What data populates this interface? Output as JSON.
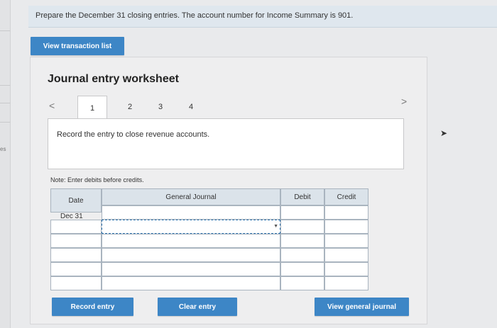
{
  "instruction": "Prepare the December 31 closing entries. The account number for Income Summary is 901.",
  "left_edge_label": "es",
  "buttons": {
    "view_transactions": "View transaction list",
    "record_entry": "Record entry",
    "clear_entry": "Clear entry",
    "view_general_journal": "View general journal"
  },
  "worksheet": {
    "title": "Journal entry worksheet",
    "prev_icon": "<",
    "next_icon": ">",
    "tabs": [
      "1",
      "2",
      "3",
      "4"
    ],
    "active_tab": "1",
    "prompt": "Record the entry to close revenue accounts.",
    "note": "Note: Enter debits before credits."
  },
  "journal": {
    "headers": {
      "date": "Date",
      "general_journal": "General Journal",
      "debit": "Debit",
      "credit": "Credit"
    },
    "rows": [
      {
        "date": "Dec 31",
        "account": "",
        "debit": "",
        "credit": ""
      },
      {
        "date": "",
        "account": "",
        "debit": "",
        "credit": ""
      },
      {
        "date": "",
        "account": "",
        "debit": "",
        "credit": ""
      },
      {
        "date": "",
        "account": "",
        "debit": "",
        "credit": ""
      },
      {
        "date": "",
        "account": "",
        "debit": "",
        "credit": ""
      },
      {
        "date": "",
        "account": "",
        "debit": "",
        "credit": ""
      }
    ]
  },
  "colors": {
    "button_blue": "#3d86c6",
    "header_bg": "#dbe3ea",
    "banner_bg": "#dfe7ee"
  }
}
